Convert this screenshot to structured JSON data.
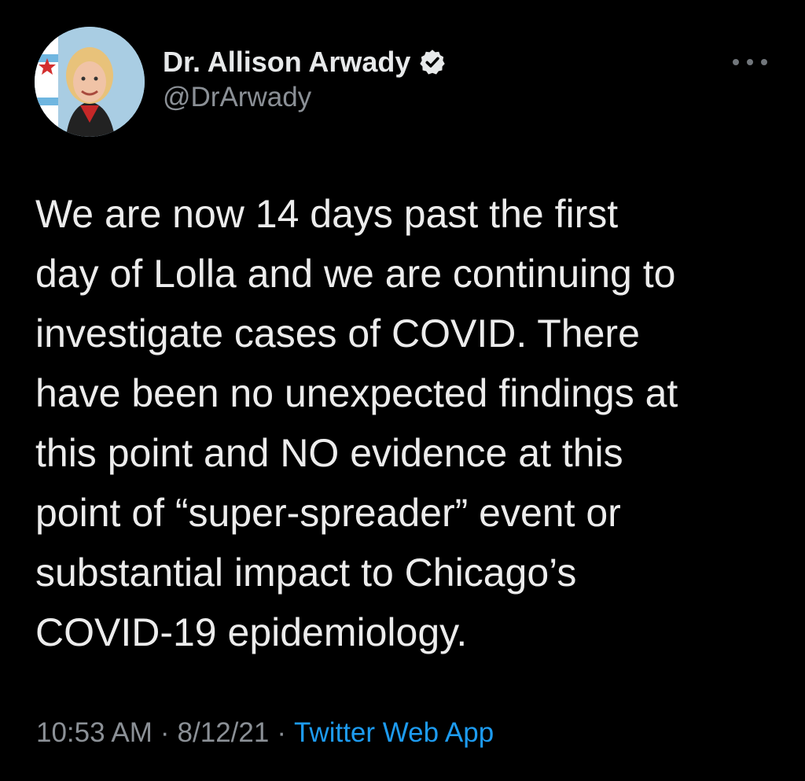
{
  "author": {
    "display_name": "Dr. Allison Arwady",
    "handle": "@DrArwady",
    "verified_icon": "verified-badge-icon",
    "avatar": "profile-photo-avatar"
  },
  "menu": {
    "icon": "more-options-icon"
  },
  "tweet": {
    "text": "We are now 14 days past the first\nday of Lolla and we are continuing to\ninvestigate cases of COVID. There\nhave been no unexpected findings at\nthis point and NO evidence at this\npoint of “super-spreader” event or\nsubstantial impact to Chicago’s\nCOVID-19 epidemiology.",
    "time": "10:53 AM",
    "separator": "·",
    "date": "8/12/21",
    "source": "Twitter Web App"
  },
  "colors": {
    "background": "#000000",
    "text": "#e7e9ea",
    "secondary": "#8b9096",
    "link": "#1d9bf0"
  }
}
